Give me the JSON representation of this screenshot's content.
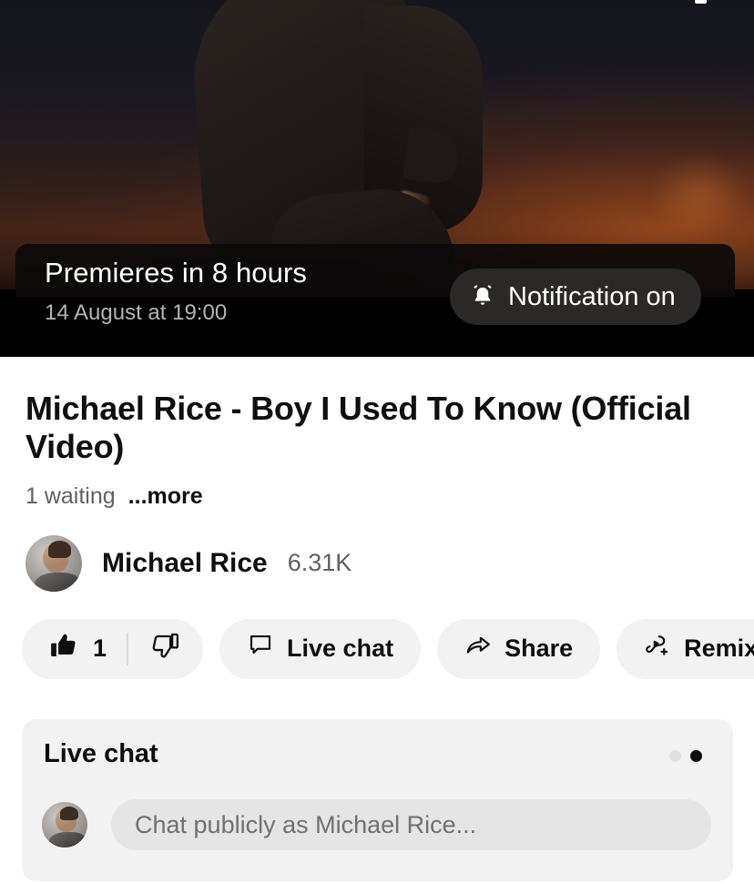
{
  "player": {
    "premiere": {
      "countdown": "Premieres in 8 hours",
      "scheduled": "14 August at 19:00",
      "notification_label": "Notification on",
      "bell_icon": "bell-ringing-icon"
    }
  },
  "video": {
    "title": "Michael Rice  - Boy I Used To Know (Official Video)",
    "waiting": "1 waiting",
    "more_label": "...more"
  },
  "channel": {
    "name": "Michael Rice",
    "subscribers": "6.31K",
    "avatar_icon": "channel-avatar"
  },
  "actions": {
    "like": {
      "label": "1",
      "icon": "thumbs-up-filled-icon"
    },
    "dislike": {
      "icon": "thumbs-down-outline-icon"
    },
    "live_chat": {
      "label": "Live chat",
      "icon": "chat-bubble-icon"
    },
    "share": {
      "label": "Share",
      "icon": "share-arrow-icon"
    },
    "remix": {
      "label": "Remix",
      "icon": "remix-icon"
    },
    "save": {
      "icon": "save-to-playlist-icon"
    }
  },
  "live_chat_card": {
    "header": "Live chat",
    "input_placeholder": "Chat publicly as Michael Rice...",
    "avatar_icon": "user-avatar",
    "pagination": {
      "dots": 2,
      "active_index": 1
    }
  },
  "colors": {
    "text_primary": "#0f0f0f",
    "text_secondary": "#606060",
    "chip_background": "#f2f2f2",
    "card_background": "#f2f2f2",
    "input_background": "#e5e5e5",
    "overlay_background": "#0c0a0a",
    "pill_background": "#2a2928"
  }
}
